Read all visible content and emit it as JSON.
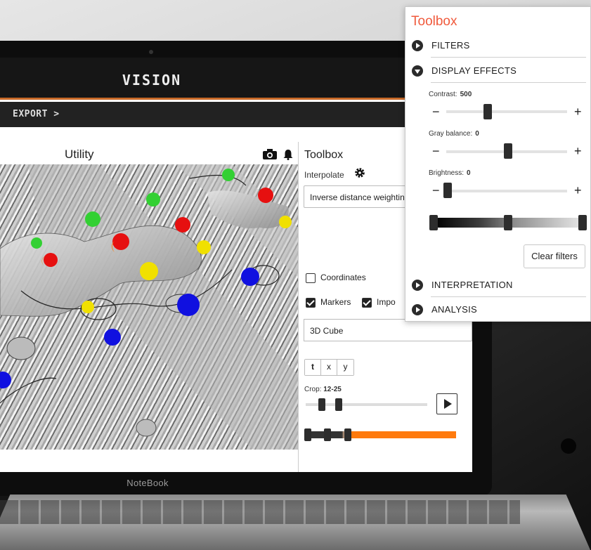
{
  "app": {
    "title": "VISION",
    "nav_export": "EXPORT >",
    "device_label": "NoteBook"
  },
  "utility": {
    "title": "Utility",
    "icons": [
      "camera-icon",
      "bell-icon"
    ]
  },
  "inner_toolbox": {
    "title": "Toolbox",
    "interpolate_label": "Interpolate",
    "interpolate_value": "Inverse distance weighting",
    "coordinates_label": "Coordinates",
    "coordinates_checked": false,
    "markers_label": "Markers",
    "markers_checked": true,
    "imported_label": "Impo",
    "imported_checked": true,
    "view_value": "3D Cube",
    "axis_buttons": [
      "t",
      "x",
      "y"
    ],
    "crop_label": "Crop:",
    "crop_value": "12-25"
  },
  "float_toolbox": {
    "title": "Toolbox",
    "sections": {
      "filters": "FILTERS",
      "display_effects": "DISPLAY EFFECTS",
      "interpretation": "INTERPRETATION",
      "analysis": "ANALYSIS"
    },
    "contrast": {
      "label": "Contrast:",
      "value": "500"
    },
    "gray_balance": {
      "label": "Gray balance:",
      "value": "0"
    },
    "brightness": {
      "label": "Brightness:",
      "value": "0"
    },
    "minus": "−",
    "plus": "+",
    "clear_filters": "Clear filters"
  },
  "colors": {
    "title_accent": "#f05a3c",
    "header_underline": "#c86a28",
    "crop_accent": "#ff7a0d"
  }
}
